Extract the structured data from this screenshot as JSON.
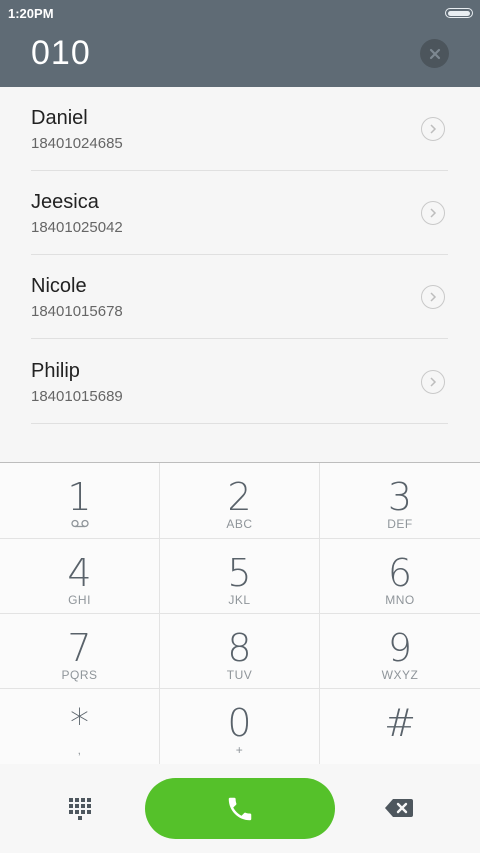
{
  "status": {
    "time": "1:20PM"
  },
  "dialer": {
    "number": "010"
  },
  "contacts": [
    {
      "name": "Daniel",
      "phone": "18401024685"
    },
    {
      "name": "Jeesica",
      "phone": "18401025042"
    },
    {
      "name": "Nicole",
      "phone": "18401015678"
    },
    {
      "name": "Philip",
      "phone": "18401015689"
    }
  ],
  "keypad": [
    {
      "digit": "1",
      "letters": ""
    },
    {
      "digit": "2",
      "letters": "ABC"
    },
    {
      "digit": "3",
      "letters": "DEF"
    },
    {
      "digit": "4",
      "letters": "GHI"
    },
    {
      "digit": "5",
      "letters": "JKL"
    },
    {
      "digit": "6",
      "letters": "MNO"
    },
    {
      "digit": "7",
      "letters": "PQRS"
    },
    {
      "digit": "8",
      "letters": "TUV"
    },
    {
      "digit": "9",
      "letters": "WXYZ"
    },
    {
      "digit": "*",
      "letters": ","
    },
    {
      "digit": "0",
      "letters": "+"
    },
    {
      "digit": "#",
      "letters": ""
    }
  ],
  "colors": {
    "header": "#5f6b75",
    "call": "#55c12a",
    "keytext": "#59626a"
  },
  "icons": {
    "clear": "close-circle-icon",
    "chevron": "chevron-right-icon",
    "voicemail": "voicemail-icon",
    "keypad": "dialpad-icon",
    "call": "phone-icon",
    "backspace": "backspace-icon"
  }
}
